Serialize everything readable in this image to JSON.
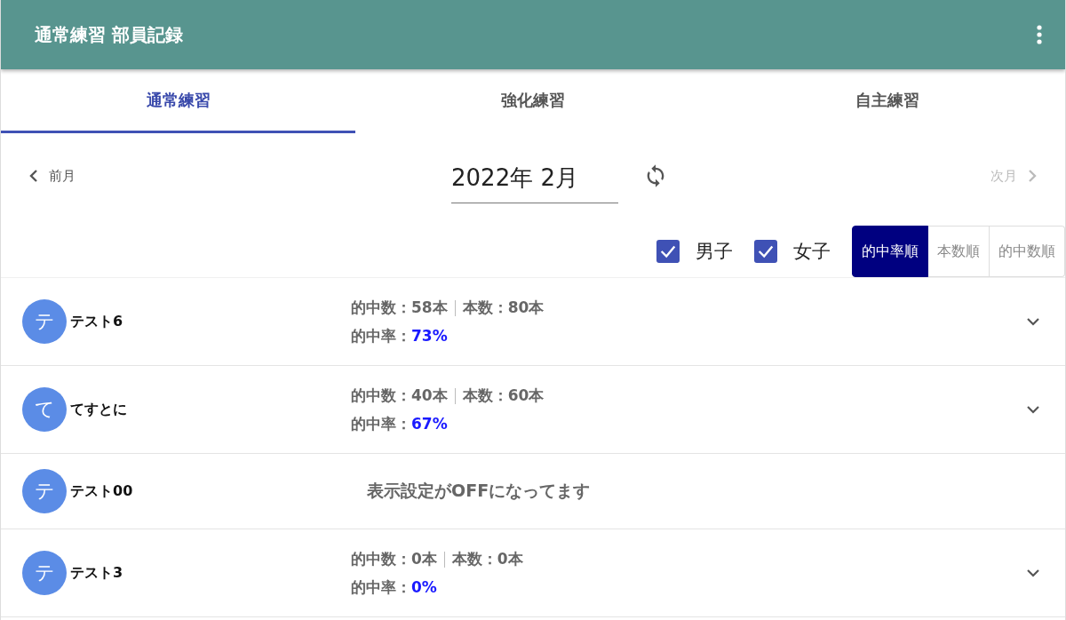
{
  "app_bar": {
    "title": "通常練習 部員記録"
  },
  "tabs": [
    {
      "label": "通常練習",
      "selected": true
    },
    {
      "label": "強化練習",
      "selected": false
    },
    {
      "label": "自主練習",
      "selected": false
    }
  ],
  "month_nav": {
    "prev": {
      "label": "前月",
      "disabled": false
    },
    "month": "2022年 2月",
    "next": {
      "label": "次月",
      "disabled": true
    }
  },
  "filters": [
    {
      "label": "男子",
      "checked": true
    },
    {
      "label": "女子",
      "checked": true
    }
  ],
  "sort_buttons": [
    {
      "label": "的中率順",
      "selected": true
    },
    {
      "label": "本数順",
      "selected": false
    },
    {
      "label": "的中数順",
      "selected": false
    }
  ],
  "members": [
    {
      "kind": "stats",
      "avatar": "テ",
      "name": "テスト6",
      "hits": "的中数：58本",
      "shots": "本数：80本",
      "rate_label": "的中率：",
      "rate": "73%"
    },
    {
      "kind": "stats",
      "avatar": "て",
      "name": "てすとに",
      "hits": "的中数：40本",
      "shots": "本数：60本",
      "rate_label": "的中率：",
      "rate": "67%"
    },
    {
      "kind": "hidden",
      "avatar": "テ",
      "name": "テスト00",
      "message": "表示設定がOFFになってます"
    },
    {
      "kind": "stats",
      "avatar": "テ",
      "name": "テスト3",
      "hits": "的中数：0本",
      "shots": "本数：0本",
      "rate_label": "的中率：",
      "rate": "0%"
    }
  ]
}
